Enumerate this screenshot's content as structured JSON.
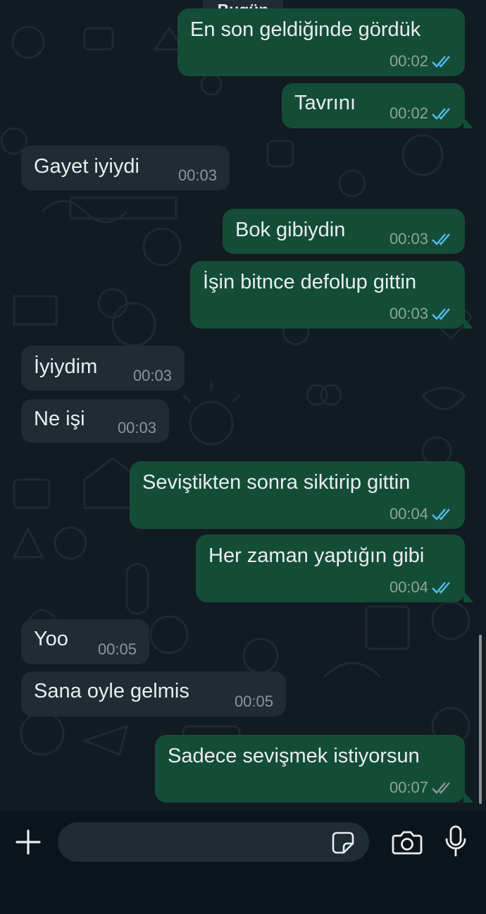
{
  "chat": {
    "date_label": "Bugün",
    "messages": [
      {
        "dir": "out",
        "text": "En son geldiğinde gördük",
        "time": "00:02",
        "status": "read"
      },
      {
        "dir": "out",
        "text": "Tavrını",
        "time": "00:02",
        "status": "read"
      },
      {
        "dir": "in",
        "text": "Gayet iyiydi",
        "time": "00:03"
      },
      {
        "dir": "out",
        "text": "Bok gibiydin",
        "time": "00:03",
        "status": "read"
      },
      {
        "dir": "out",
        "text": "İşin bitnce defolup gittin",
        "time": "00:03",
        "status": "read"
      },
      {
        "dir": "in",
        "text": "İyiydim",
        "time": "00:03"
      },
      {
        "dir": "in",
        "text": "Ne işi",
        "time": "00:03"
      },
      {
        "dir": "out",
        "text": "Sevіştikten sonra siktirip gittin",
        "time": "00:04",
        "status": "read"
      },
      {
        "dir": "out",
        "text": "Her zaman yaptığın gibi",
        "time": "00:04",
        "status": "read"
      },
      {
        "dir": "in",
        "text": "Yoo",
        "time": "00:05"
      },
      {
        "dir": "in",
        "text": "Sana oyle gelmis",
        "time": "00:05"
      },
      {
        "dir": "out",
        "text": "Sadece sevişmek istiyorsun",
        "time": "00:07",
        "status": "delivered"
      }
    ]
  },
  "composer": {
    "input_value": "",
    "input_placeholder": "",
    "icons": [
      "plus-icon",
      "sticker-icon",
      "camera-icon",
      "microphone-icon"
    ]
  },
  "colors": {
    "background": "#111b21",
    "outgoing_bubble": "#144d37",
    "incoming_bubble": "#1f2c33",
    "read_ticks": "#53bdeb",
    "delivered_ticks": "#8696a0"
  }
}
